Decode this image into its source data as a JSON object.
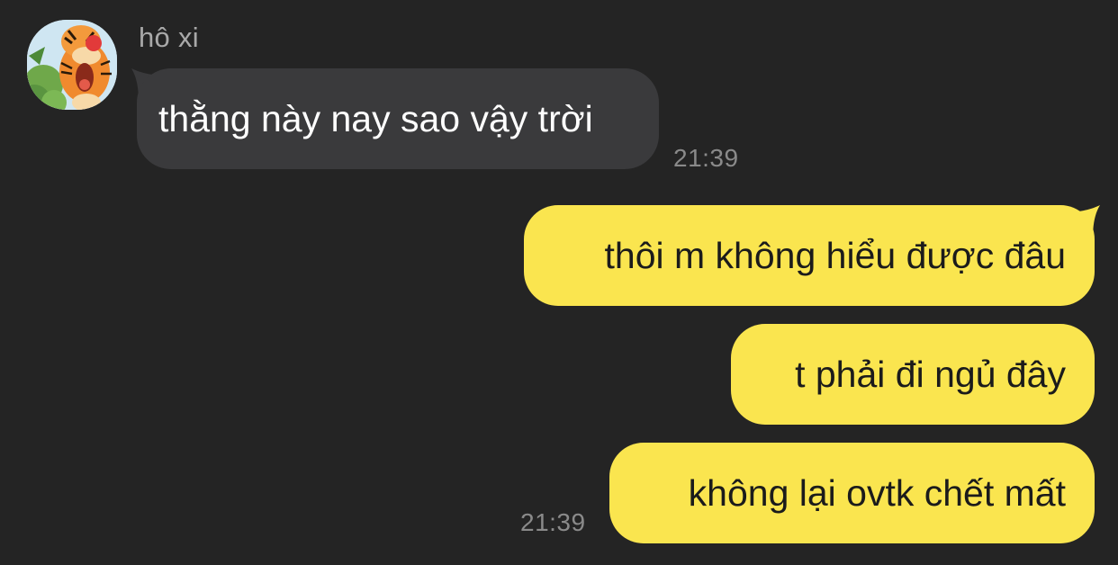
{
  "contact": {
    "name": "hô xi",
    "avatar_icon": "tigger-avatar-icon"
  },
  "messages": {
    "incoming": [
      {
        "text": "thằng này nay sao vậy trời",
        "time": "21:39"
      }
    ],
    "outgoing": [
      {
        "text": "thôi m không hiểu được đâu"
      },
      {
        "text": "t phải đi ngủ đây"
      },
      {
        "text": "không lại ovtk chết mất",
        "time": "21:39"
      }
    ]
  },
  "colors": {
    "background": "#242424",
    "incoming_bubble": "#3a3a3c",
    "outgoing_bubble": "#fae54f",
    "timestamp": "#8a8a8a"
  }
}
